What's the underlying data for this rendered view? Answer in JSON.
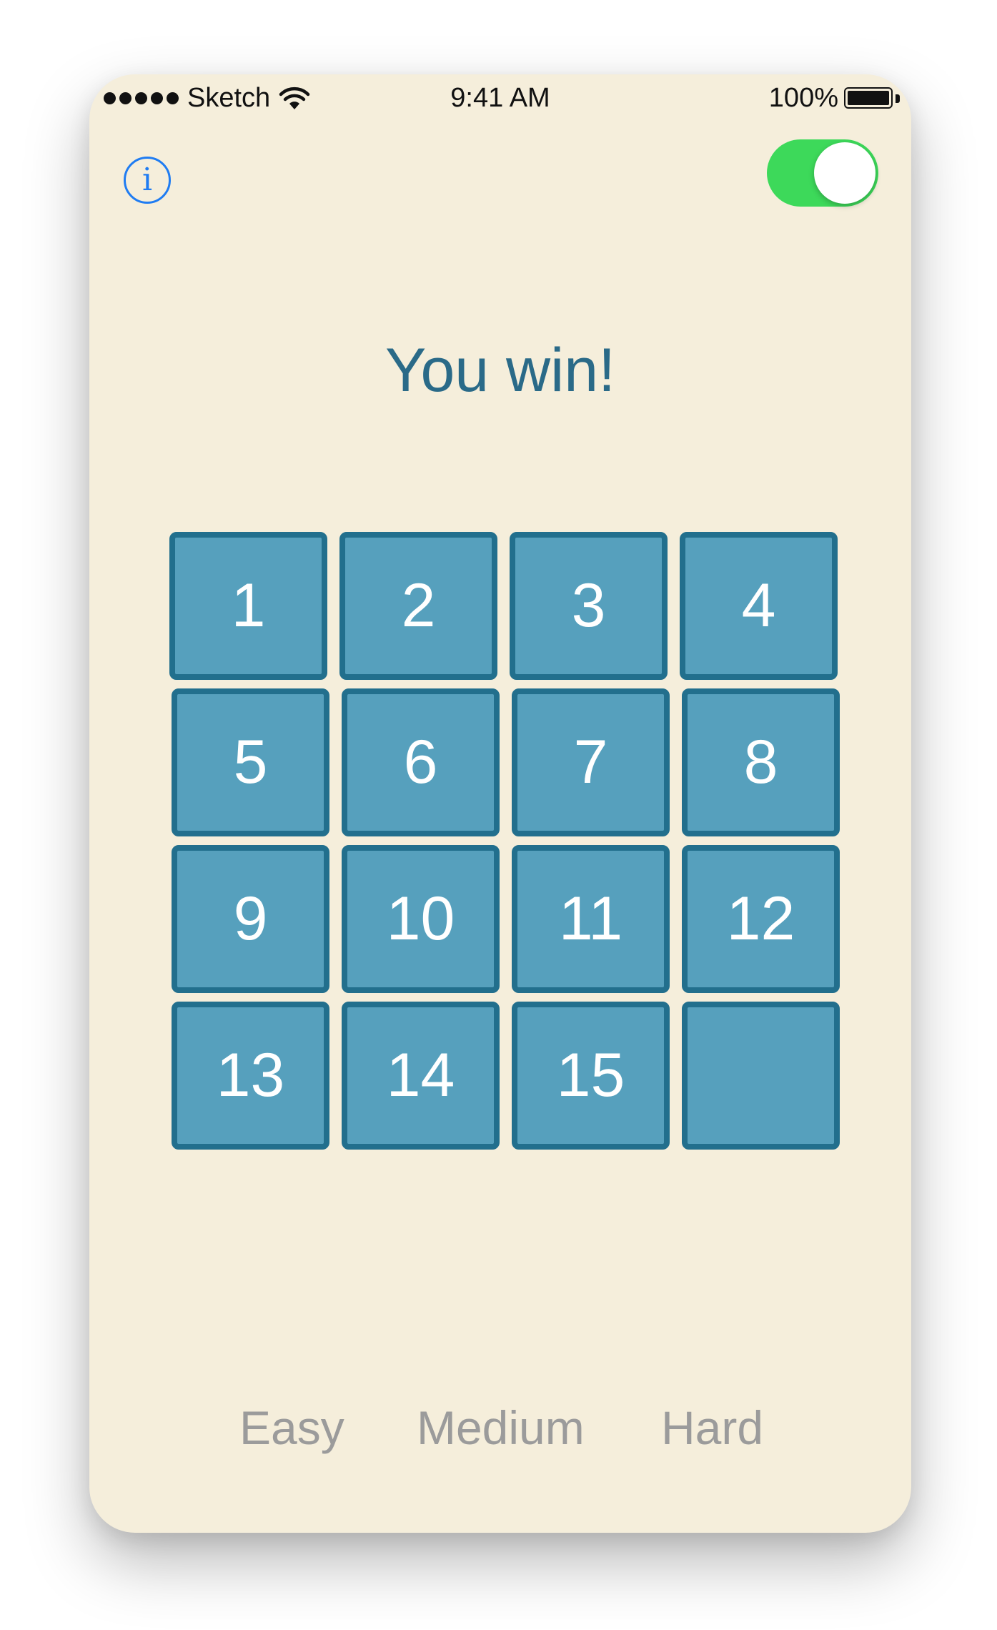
{
  "status_bar": {
    "carrier": "Sketch",
    "time": "9:41 AM",
    "battery": "100%"
  },
  "info_button": {
    "icon": "info-icon",
    "glyph": "i",
    "color": "#1f7cf2"
  },
  "toggle": {
    "on": true,
    "color": "#3dd95a"
  },
  "message": "You win!",
  "board": {
    "rows": 4,
    "columns": 4,
    "tiles": [
      "1",
      "2",
      "3",
      "4",
      "5",
      "6",
      "7",
      "8",
      "9",
      "10",
      "11",
      "12",
      "13",
      "14",
      "15",
      ""
    ],
    "tile_color": "#56a0bd",
    "tile_border_color": "#226f8d"
  },
  "difficulty": {
    "options": [
      "Easy",
      "Medium",
      "Hard"
    ]
  },
  "colors": {
    "background": "#f5eedb",
    "message": "#2a6a88",
    "difficulty_text": "#9b9b9b"
  }
}
